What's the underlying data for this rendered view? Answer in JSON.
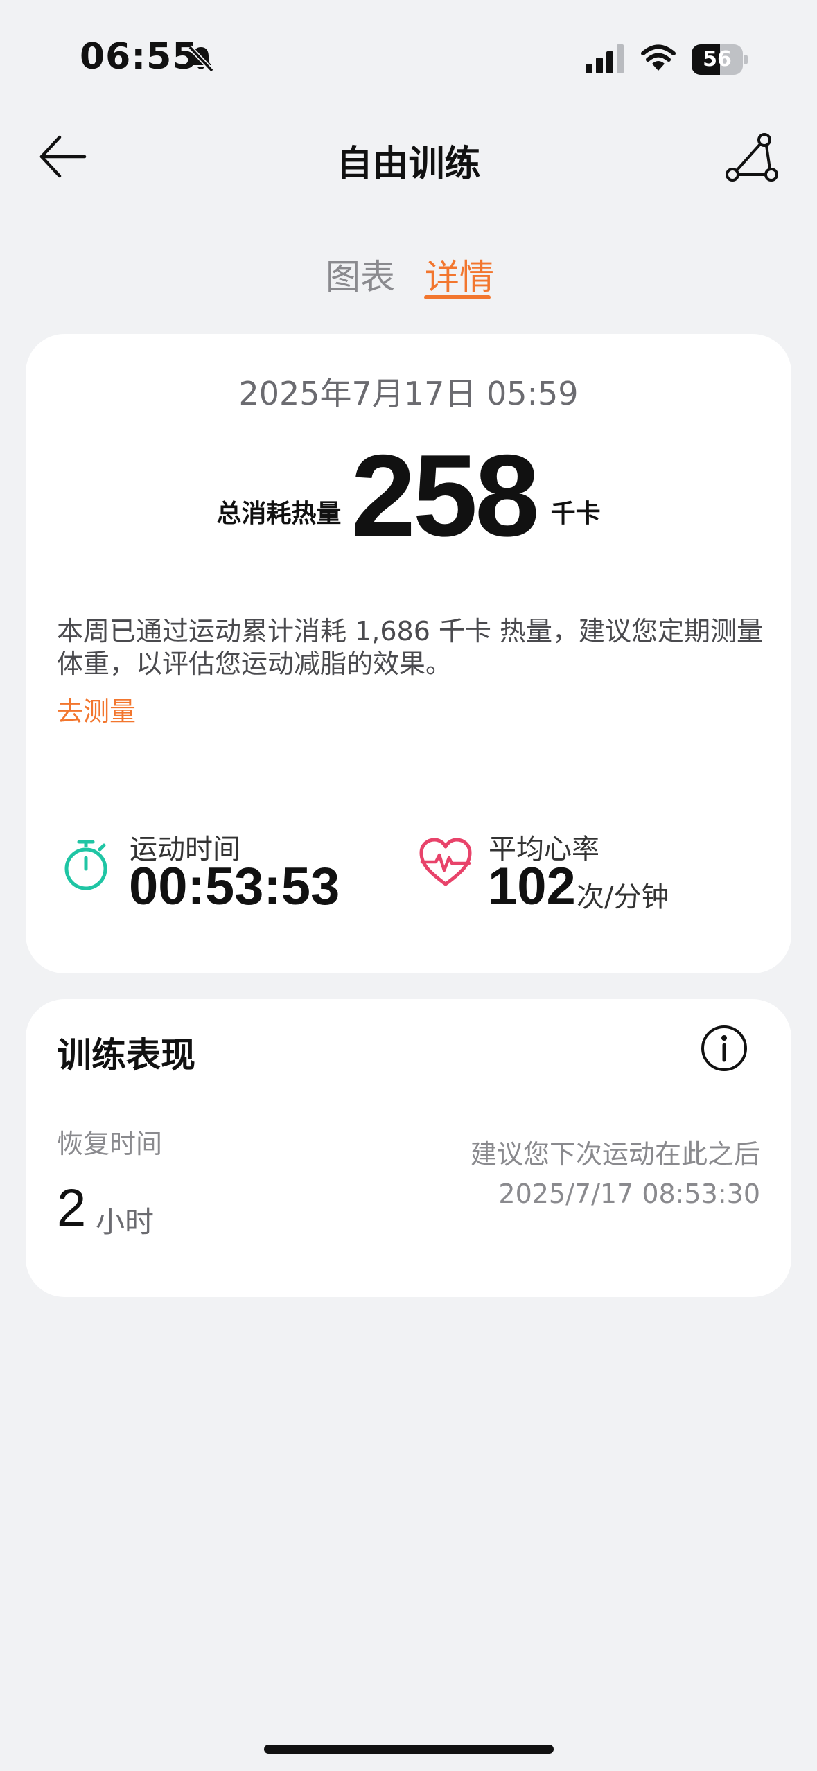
{
  "status_bar": {
    "time": "06:55",
    "battery": "56",
    "battery_level": 0.56
  },
  "header": {
    "title": "自由训练"
  },
  "tabs": [
    {
      "label": "图表",
      "active": false
    },
    {
      "label": "详情",
      "active": true
    }
  ],
  "summary": {
    "datetime": "2025年7月17日 05:59",
    "calories_label": "总消耗热量",
    "calories_value": "258",
    "calories_unit": "千卡",
    "description": "本周已通过运动累计消耗 1,686 千卡 热量，建议您定期测量体重，以评估您运动减脂的效果。",
    "measure_link": "去测量",
    "duration_label": "运动时间",
    "duration_value": "00:53:53",
    "heart_rate_label": "平均心率",
    "heart_rate_value": "102",
    "heart_rate_unit": "次/分钟"
  },
  "performance": {
    "title": "训练表现",
    "recovery_label": "恢复时间",
    "recovery_value": "2",
    "recovery_unit": "小时",
    "suggestion_line1": "建议您下次运动在此之后",
    "suggestion_line2": "2025/7/17 08:53:30"
  },
  "colors": {
    "accent": "#f2762e",
    "timer": "#1fc5a4",
    "heart": "#e8436a",
    "background": "#f1f2f4",
    "card": "#ffffff"
  },
  "icons": [
    "bell-slash-icon",
    "signal-icon",
    "wifi-icon",
    "battery-icon",
    "arrow-left-icon",
    "route-icon",
    "stopwatch-icon",
    "heart-pulse-icon",
    "info-icon"
  ]
}
